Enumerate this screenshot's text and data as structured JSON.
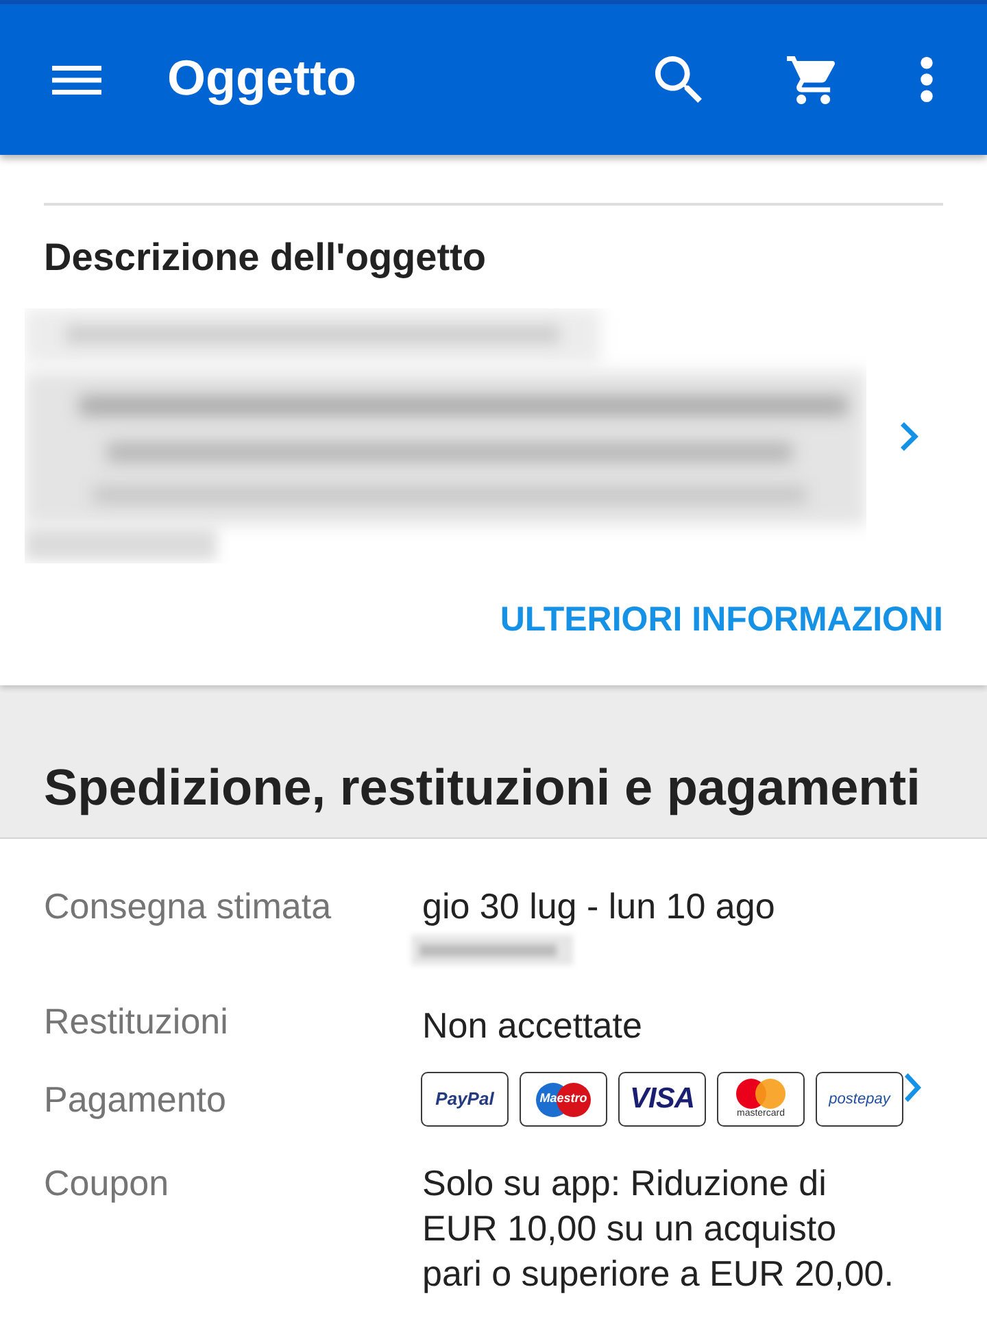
{
  "app_bar": {
    "title": "Oggetto"
  },
  "description": {
    "heading": "Descrizione dell'oggetto",
    "more_link": "ULTERIORI INFORMAZIONI"
  },
  "shipping": {
    "heading": "Spedizione, restituzioni e pagamenti",
    "rows": [
      {
        "kind": "delivery",
        "label": "Consegna stimata",
        "value": "gio 30 lug - lun 10 ago"
      },
      {
        "kind": "text",
        "label": "Restituzioni",
        "value": "Non accettate"
      },
      {
        "kind": "payment",
        "label": "Pagamento",
        "methods": [
          {
            "kind": "wordmark",
            "label": "PayPal"
          },
          {
            "kind": "circles-overlay",
            "label": "Maestro"
          },
          {
            "kind": "wordmark-bold",
            "label": "VISA"
          },
          {
            "kind": "circles-caption",
            "label": "mastercard"
          },
          {
            "kind": "wordmark-italic",
            "label": "postepay"
          }
        ]
      },
      {
        "kind": "paragraph",
        "label": "Coupon",
        "lines": [
          "Solo su app: Riduzione di",
          "EUR 10,00 su un acquisto",
          "pari o superiore a EUR 20,00."
        ]
      }
    ]
  }
}
